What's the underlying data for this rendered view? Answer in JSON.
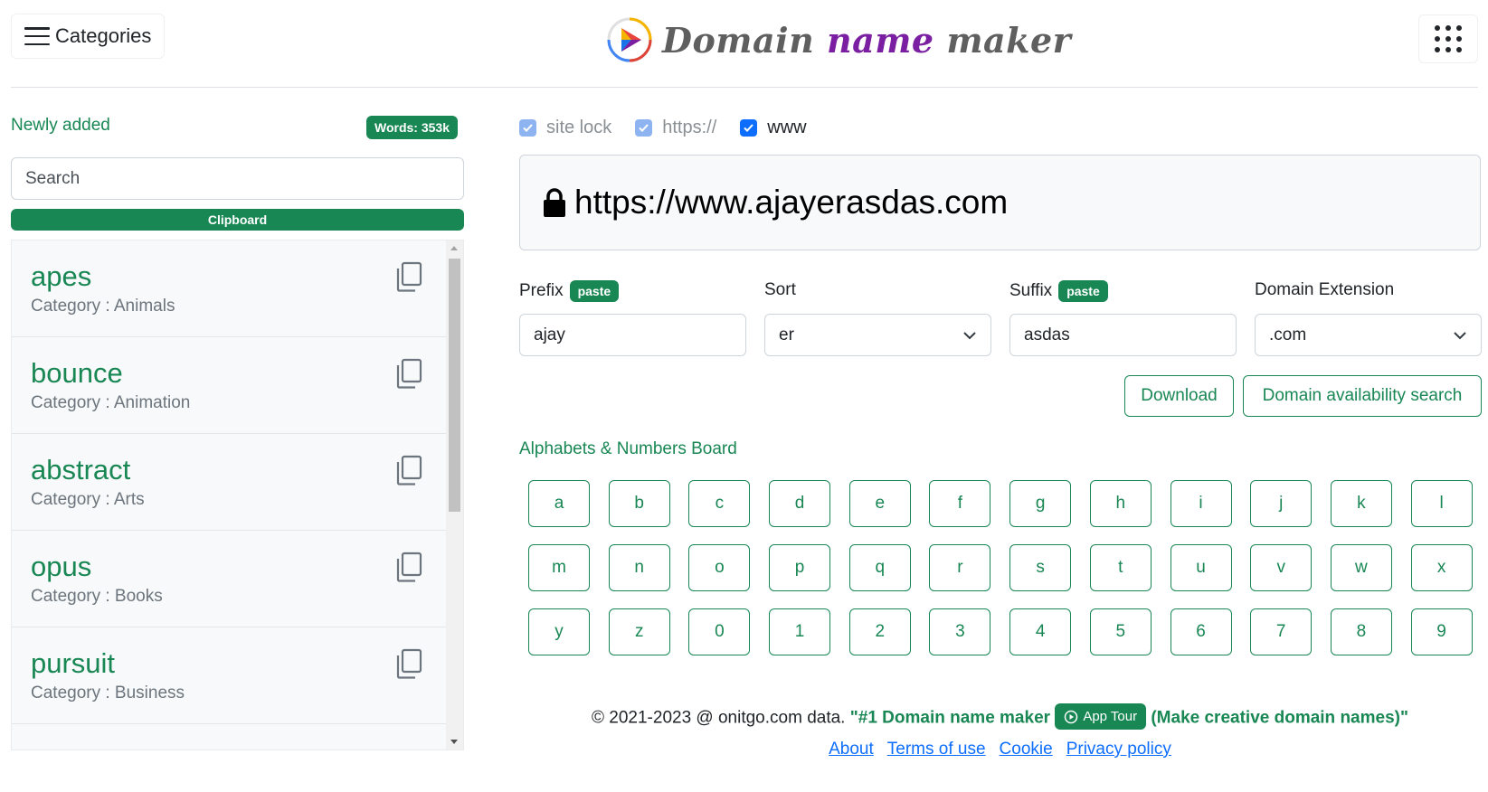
{
  "header": {
    "categories_label": "Categories",
    "logo": {
      "word1": "Domain",
      "word2": "name",
      "word3": "maker"
    }
  },
  "left": {
    "newly_added": "Newly added",
    "words_badge": "Words: 353k",
    "search_placeholder": "Search",
    "clipboard_label": "Clipboard",
    "items": [
      {
        "word": "apes",
        "category": "Category : Animals"
      },
      {
        "word": "bounce",
        "category": "Category : Animation"
      },
      {
        "word": "abstract",
        "category": "Category : Arts"
      },
      {
        "word": "opus",
        "category": "Category : Books"
      },
      {
        "word": "pursuit",
        "category": "Category : Business"
      }
    ]
  },
  "options": {
    "site_lock": {
      "label": "site lock",
      "checked": true
    },
    "https": {
      "label": "https://",
      "checked": true
    },
    "www": {
      "label": "www",
      "checked": true
    }
  },
  "url_display": "https://www.ajayerasdas.com",
  "form": {
    "prefix_label": "Prefix",
    "prefix_paste": "paste",
    "prefix_value": "ajay",
    "sort_label": "Sort",
    "sort_value": "er",
    "suffix_label": "Suffix",
    "suffix_paste": "paste",
    "suffix_value": "asdas",
    "extension_label": "Domain Extension",
    "extension_value": ".com"
  },
  "actions": {
    "download": "Download",
    "availability": "Domain availability search"
  },
  "board": {
    "title": "Alphabets & Numbers Board",
    "keys": [
      "a",
      "b",
      "c",
      "d",
      "e",
      "f",
      "g",
      "h",
      "i",
      "j",
      "k",
      "l",
      "m",
      "n",
      "o",
      "p",
      "q",
      "r",
      "s",
      "t",
      "u",
      "v",
      "w",
      "x",
      "y",
      "z",
      "0",
      "1",
      "2",
      "3",
      "4",
      "5",
      "6",
      "7",
      "8",
      "9"
    ]
  },
  "footer": {
    "copyright": "© 2021-2023 @ onitgo.com data.",
    "tag_open": "\"#1 Domain name maker",
    "tour_label": "App Tour",
    "tag_close": "(Make creative domain names)\"",
    "links": [
      "About",
      "Terms of use",
      "Cookie",
      "Privacy policy"
    ]
  },
  "colors": {
    "accent_green": "#198754",
    "link_blue": "#0d6efd",
    "logo_purple": "#7b1fa2"
  }
}
